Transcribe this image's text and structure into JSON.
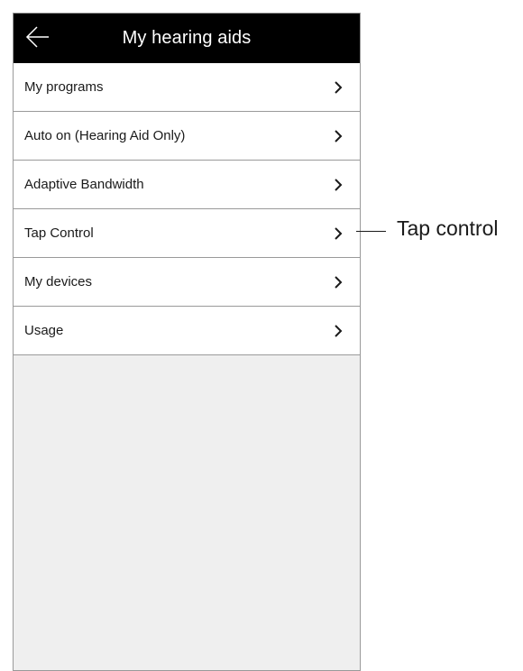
{
  "header": {
    "title": "My hearing aids",
    "back_icon": "arrow-left-icon"
  },
  "list": {
    "items": [
      {
        "label": "My programs"
      },
      {
        "label": "Auto on (Hearing Aid Only)"
      },
      {
        "label": "Adaptive Bandwidth"
      },
      {
        "label": "Tap Control"
      },
      {
        "label": "My devices"
      },
      {
        "label": "Usage"
      }
    ],
    "chevron_icon": "chevron-right-icon"
  },
  "callout": {
    "label": "Tap control"
  },
  "colors": {
    "header_bg": "#000000",
    "header_text": "#ffffff",
    "list_bg": "#ffffff",
    "empty_bg": "#efefef",
    "divider": "#9a9a9a",
    "text": "#1a1a1a"
  }
}
